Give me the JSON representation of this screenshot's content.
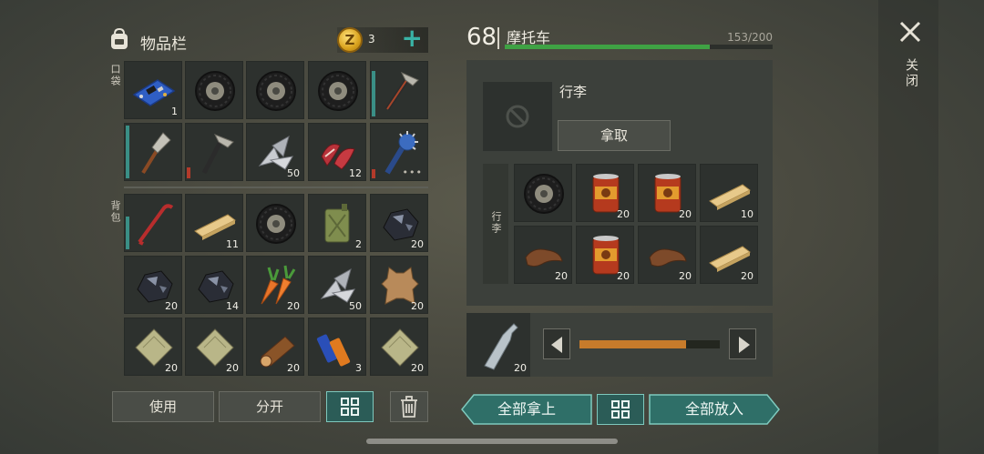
{
  "inventory": {
    "title": "物品栏",
    "coins": "3",
    "coin_letter": "Z",
    "pocket_label": "口袋",
    "backpack_label": "背包",
    "pocket": [
      {
        "name": "circuit-board",
        "qty": ""
      },
      {
        "name": "tire",
        "qty": ""
      },
      {
        "name": "tire",
        "qty": ""
      },
      {
        "name": "tire",
        "qty": ""
      },
      {
        "name": "hatchet",
        "qty": "",
        "durability": "teal"
      },
      {
        "name": "shovel",
        "qty": "",
        "durability": "teal"
      },
      {
        "name": "hatchet",
        "qty": "",
        "durability": "red"
      },
      {
        "name": "metal-scraps",
        "qty": "50"
      },
      {
        "name": "raw-meat",
        "qty": "12"
      },
      {
        "name": "spiked-club",
        "qty": "",
        "durability": "red",
        "more": "•••"
      }
    ],
    "pocket_first_qty": "1",
    "backpack": [
      {
        "name": "crowbar",
        "qty": "",
        "durability": "teal"
      },
      {
        "name": "wood-plank",
        "qty": "11"
      },
      {
        "name": "tire",
        "qty": ""
      },
      {
        "name": "jerry-can",
        "qty": "2"
      },
      {
        "name": "coal-ore",
        "qty": "20"
      },
      {
        "name": "coal-ore",
        "qty": "20"
      },
      {
        "name": "coal-ore",
        "qty": "14"
      },
      {
        "name": "carrots",
        "qty": "20"
      },
      {
        "name": "metal-scraps",
        "qty": "50"
      },
      {
        "name": "animal-hide",
        "qty": "20"
      },
      {
        "name": "cloth-sack",
        "qty": "20"
      },
      {
        "name": "cloth-sack",
        "qty": "20"
      },
      {
        "name": "log",
        "qty": "20"
      },
      {
        "name": "batteries",
        "qty": "3"
      },
      {
        "name": "cloth-sack",
        "qty": "20"
      }
    ],
    "buttons": {
      "use": "使用",
      "split": "分开"
    }
  },
  "vehicle": {
    "level": "68",
    "name": "摩托车",
    "hp": "153/200",
    "hp_fraction": 0.765,
    "trunk_name": "行李",
    "take_label": "拿取",
    "trunk_side_label": "行李",
    "trunk_items": [
      {
        "name": "tire",
        "qty": ""
      },
      {
        "name": "canned-food",
        "qty": "20"
      },
      {
        "name": "canned-food",
        "qty": "20"
      },
      {
        "name": "wood-plank",
        "qty": "10"
      },
      {
        "name": "leather",
        "qty": "20"
      },
      {
        "name": "canned-food",
        "qty": "20"
      },
      {
        "name": "leather",
        "qty": "20"
      },
      {
        "name": "wood-plank",
        "qty": "20"
      }
    ],
    "transfer": {
      "item": "water-bottle",
      "qty": "20",
      "fraction": 0.76
    },
    "take_all": "全部拿上",
    "put_all": "全部放入"
  },
  "close_label": "关闭",
  "colors": {
    "accent_teal": "#39b3a6",
    "hp_green": "#3fa244",
    "slider_orange": "#c77b2b"
  }
}
